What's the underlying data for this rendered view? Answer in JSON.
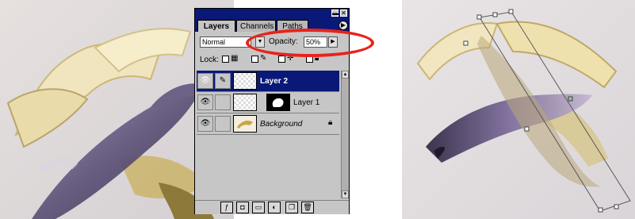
{
  "palette": {
    "title_buttons": {
      "minimize": "▬",
      "close": "✕"
    },
    "tabs": [
      {
        "label": "Layers",
        "active": true
      },
      {
        "label": "Channels",
        "active": false
      },
      {
        "label": "Paths",
        "active": false
      }
    ],
    "menu_icon": "▶",
    "blend_mode": "Normal",
    "opacity_label": "Opacity:",
    "opacity_value": "50%",
    "lock_label": "Lock:",
    "layers": [
      {
        "name": "Layer 2",
        "selected": true,
        "link_icon": "brush-icon",
        "has_mask": false,
        "locked": false
      },
      {
        "name": "Layer 1",
        "selected": false,
        "link_icon": "",
        "has_mask": true,
        "locked": false
      },
      {
        "name": "Background",
        "selected": false,
        "link_icon": "",
        "has_mask": false,
        "locked": true
      }
    ],
    "bottom_icons": [
      "layer-style-icon",
      "add-mask-icon",
      "new-set-icon",
      "adjustment-layer-icon",
      "new-layer-icon",
      "trash-icon"
    ]
  },
  "colors": {
    "titlebar": "#0a1878",
    "selected_row": "#0a1878",
    "highlight_ellipse": "#e8231b"
  }
}
